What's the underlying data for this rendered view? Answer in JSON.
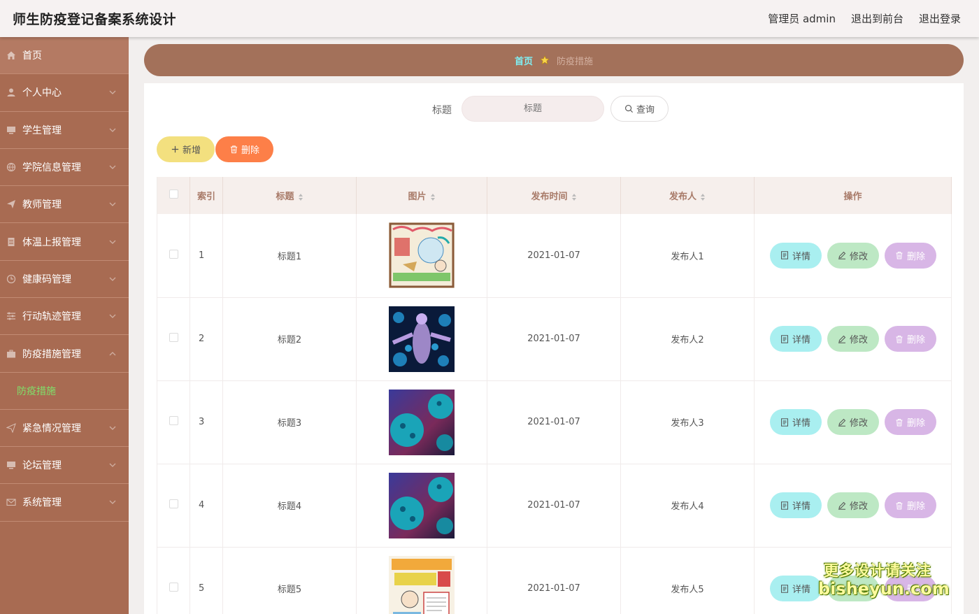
{
  "header": {
    "title": "师生防疫登记备案系统设计",
    "user_label": "管理员 admin",
    "exit_front": "退出到前台",
    "logout": "退出登录"
  },
  "sidebar": {
    "items": [
      {
        "label": "首页",
        "icon": "home-icon"
      },
      {
        "label": "个人中心",
        "icon": "user-icon"
      },
      {
        "label": "学生管理",
        "icon": "monitor-icon"
      },
      {
        "label": "学院信息管理",
        "icon": "globe-icon"
      },
      {
        "label": "教师管理",
        "icon": "send-icon"
      },
      {
        "label": "体温上报管理",
        "icon": "document-icon"
      },
      {
        "label": "健康码管理",
        "icon": "clock-icon"
      },
      {
        "label": "行动轨迹管理",
        "icon": "sliders-icon"
      },
      {
        "label": "防疫措施管理",
        "icon": "briefcase-icon"
      },
      {
        "label": "紧急情况管理",
        "icon": "send-icon"
      },
      {
        "label": "论坛管理",
        "icon": "monitor-icon"
      },
      {
        "label": "系统管理",
        "icon": "mail-icon"
      }
    ],
    "active_sub": "防疫措施"
  },
  "breadcrumb": {
    "home": "首页",
    "current": "防疫措施"
  },
  "search": {
    "label": "标题",
    "placeholder": "标题",
    "button": "查询"
  },
  "actions": {
    "add": "新增",
    "delete": "删除"
  },
  "table": {
    "columns": [
      "索引",
      "标题",
      "图片",
      "发布时间",
      "发布人",
      "操作"
    ],
    "rows": [
      {
        "index": "1",
        "title": "标题1",
        "date": "2021-01-07",
        "publisher": "发布人1"
      },
      {
        "index": "2",
        "title": "标题2",
        "date": "2021-01-07",
        "publisher": "发布人2"
      },
      {
        "index": "3",
        "title": "标题3",
        "date": "2021-01-07",
        "publisher": "发布人3"
      },
      {
        "index": "4",
        "title": "标题4",
        "date": "2021-01-07",
        "publisher": "发布人4"
      },
      {
        "index": "5",
        "title": "标题5",
        "date": "2021-01-07",
        "publisher": "发布人5"
      }
    ],
    "row_buttons": {
      "detail": "详情",
      "edit": "修改",
      "delete": "删除"
    }
  },
  "watermark": {
    "line1": "更多设计请关注",
    "line2": "bisheyun.com"
  },
  "colors": {
    "sidebar": "#a86b52",
    "breadcrumb": "#a3715a",
    "active_sub": "#7fe06a",
    "add_button": "#f3e07f",
    "delete_button": "#fd7f48",
    "detail_button": "#a9eff0",
    "edit_button": "#bde8c4",
    "remove_button": "#d8b6e6"
  }
}
